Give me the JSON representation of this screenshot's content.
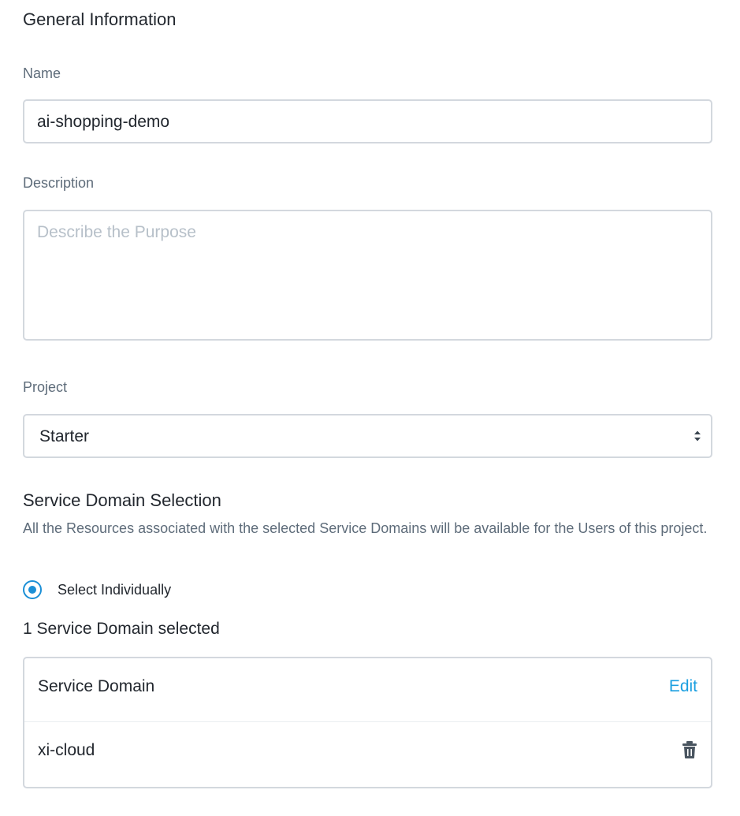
{
  "general": {
    "title": "General Information",
    "name_label": "Name",
    "name_value": "ai-shopping-demo",
    "description_label": "Description",
    "description_placeholder": "Describe the Purpose",
    "project_label": "Project",
    "project_selected": "Starter"
  },
  "service_domain": {
    "title": "Service Domain Selection",
    "help_text": "All the Resources associated with the selected Service Domains will be available for the Users of this project.",
    "radio_label": "Select Individually",
    "selected_count_text": "1 Service Domain selected",
    "table": {
      "header": "Service Domain",
      "edit_label": "Edit",
      "rows": [
        {
          "name": "xi-cloud"
        }
      ]
    }
  },
  "colors": {
    "accent": "#1b9fe0",
    "label": "#5e6c7a",
    "border": "#d3d8de",
    "text": "#22272e"
  },
  "icons": {
    "select": "updown-chevron-icon",
    "delete": "trash-icon"
  }
}
